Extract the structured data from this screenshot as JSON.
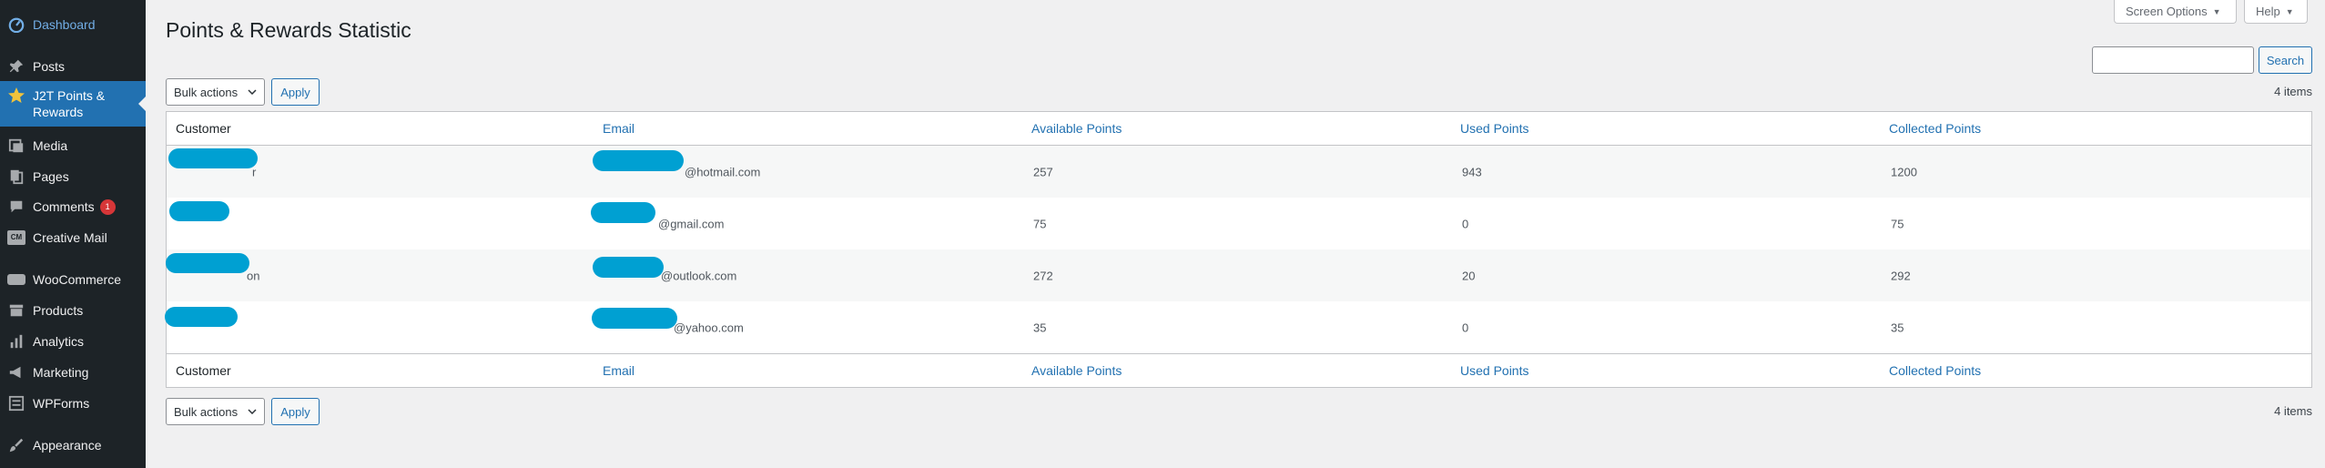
{
  "sidebar": {
    "items": [
      {
        "label": "Dashboard"
      },
      {
        "label": "Posts"
      },
      {
        "label": "J2T Points & Rewards"
      },
      {
        "label": "Media"
      },
      {
        "label": "Pages"
      },
      {
        "label": "Comments",
        "badge": "1"
      },
      {
        "label": "Creative Mail",
        "icon_text": "CM"
      },
      {
        "label": "WooCommerce"
      },
      {
        "label": "Products"
      },
      {
        "label": "Analytics"
      },
      {
        "label": "Marketing"
      },
      {
        "label": "WPForms"
      },
      {
        "label": "Appearance"
      }
    ]
  },
  "header": {
    "title": "Points & Rewards Statistic",
    "screen_options": "Screen Options",
    "help": "Help"
  },
  "search": {
    "button": "Search",
    "value": ""
  },
  "bulk": {
    "select_label": "Bulk actions",
    "apply": "Apply"
  },
  "items_count": "4 items",
  "table": {
    "columns": [
      "Customer",
      "Email",
      "Available Points",
      "Used Points",
      "Collected Points"
    ],
    "rows": [
      {
        "customer_suffix": "r",
        "email_domain": "@hotmail.com",
        "available": "257",
        "used": "943",
        "collected": "1200"
      },
      {
        "customer_suffix": "",
        "email_domain": "@gmail.com",
        "available": "75",
        "used": "0",
        "collected": "75"
      },
      {
        "customer_suffix": "on",
        "email_domain": "@outlook.com",
        "available": "272",
        "used": "20",
        "collected": "292"
      },
      {
        "customer_suffix": "",
        "email_domain": "@yahoo.com",
        "available": "35",
        "used": "0",
        "collected": "35"
      }
    ]
  },
  "colors": {
    "sidebar_bg": "#1d2327",
    "accent": "#2271b1",
    "redaction": "#00a0d2",
    "badge": "#d63638"
  }
}
